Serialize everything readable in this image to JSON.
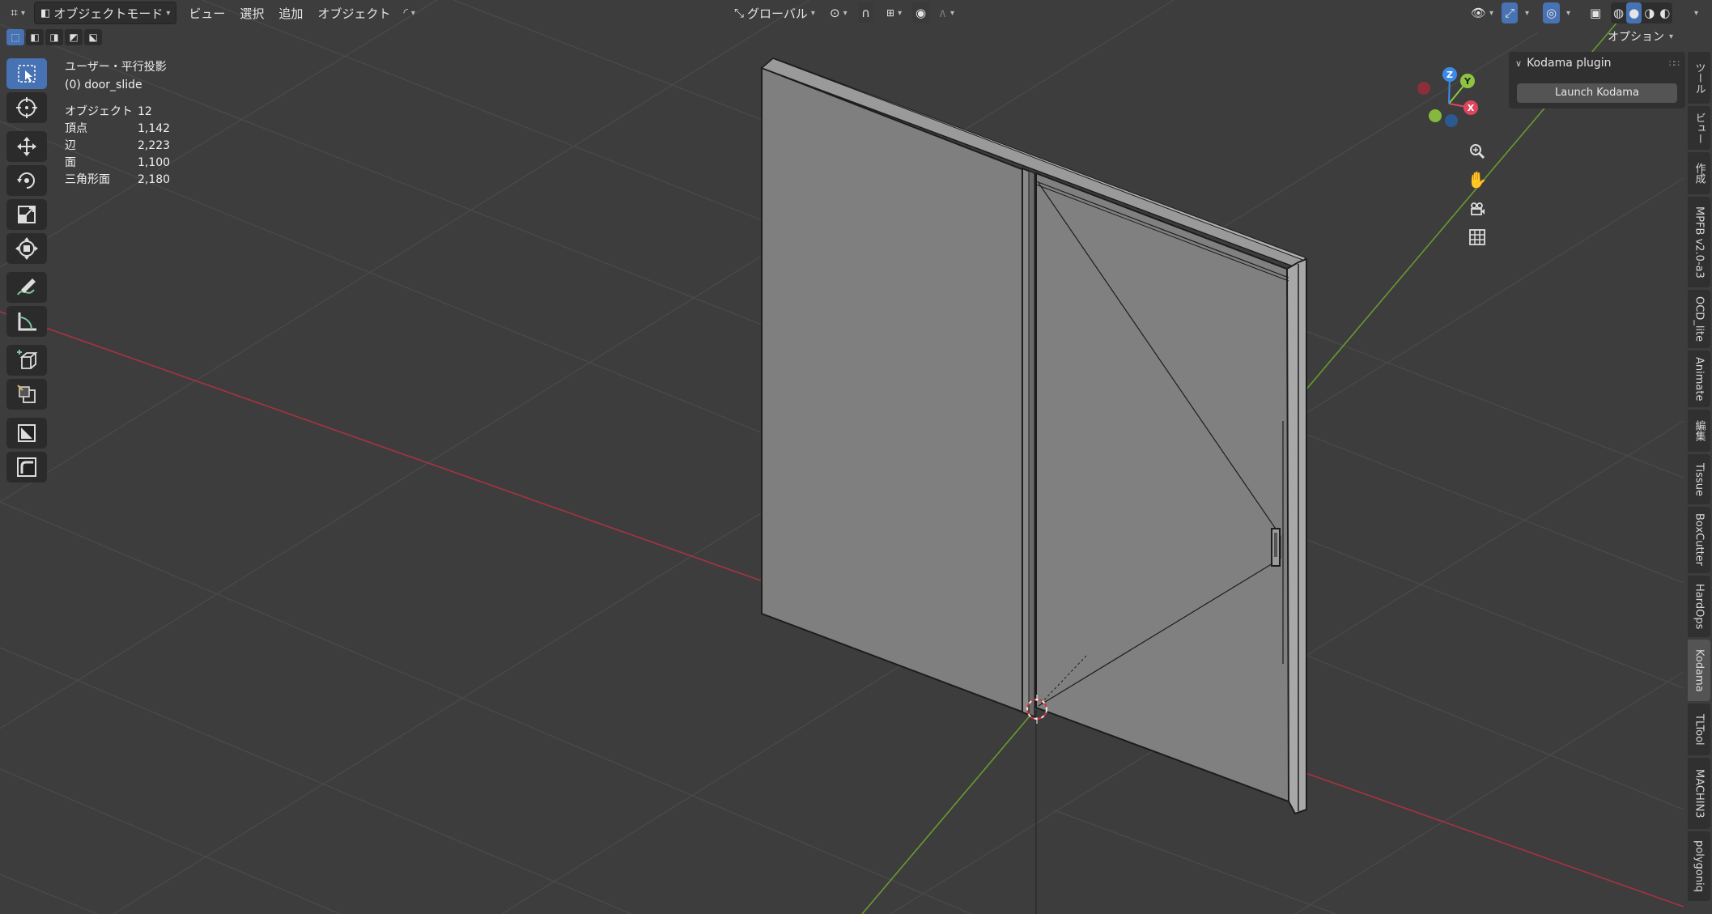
{
  "header": {
    "editor_type_icon": "editor-type-icon",
    "mode_label": "オブジェクトモード",
    "menus": [
      "ビュー",
      "選択",
      "追加",
      "オブジェクト"
    ],
    "orientation_label": "グローバル"
  },
  "options_label": "オプション",
  "viewport": {
    "view_name": "ユーザー・平行投影",
    "object_name": "(0) door_slide"
  },
  "stats": [
    {
      "label": "オブジェクト",
      "value": "12"
    },
    {
      "label": "頂点",
      "value": "1,142"
    },
    {
      "label": "辺",
      "value": "2,223"
    },
    {
      "label": "面",
      "value": "1,100"
    },
    {
      "label": "三角形面",
      "value": "2,180"
    }
  ],
  "gizmo": {
    "x": "X",
    "y": "Y",
    "z": "Z"
  },
  "panel": {
    "title": "Kodama plugin",
    "button": "Launch Kodama"
  },
  "tabs": [
    "ツール",
    "ビュー",
    "作成",
    "MPFB v2.0-a3",
    "OCD_lite",
    "Animate",
    "編集",
    "Tissue",
    "BoxCutter",
    "HardOps",
    "Kodama",
    "TLTool",
    "MACHIN3",
    "polygoniq"
  ],
  "active_tab": "Kodama",
  "colors": {
    "accent": "#4772b3",
    "axis_x": "#e0455c",
    "axis_y": "#8fc443",
    "axis_z": "#3b8be6",
    "viewport_bg": "#3d3d3d"
  }
}
